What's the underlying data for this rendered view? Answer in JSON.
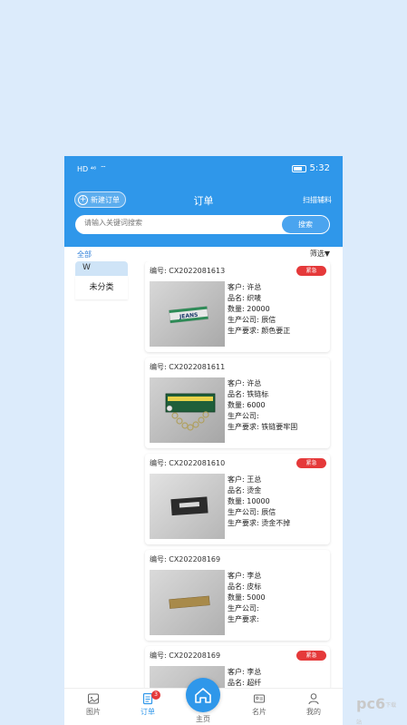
{
  "status_bar": {
    "network": "HD ⁴⁶",
    "time": "5:32"
  },
  "header": {
    "new_order_label": "新建订单",
    "title": "订单",
    "scan_label": "扫描辅料"
  },
  "search": {
    "placeholder": "请输入关键词搜索",
    "button_label": "搜索"
  },
  "filter": {
    "all_label": "全部",
    "filter_label": "筛选▼"
  },
  "sidebar": {
    "group_label": "W",
    "items": [
      {
        "label": "未分类"
      }
    ]
  },
  "orders": [
    {
      "number": "编号: CX2022081613",
      "urgent": "紧急",
      "customer": "客户: 许总",
      "product": "品名: 织唛",
      "quantity": "数量: 20000",
      "company": "生产公司: 辰信",
      "requirement": "生产要求: 颜色要正",
      "image_text": "JEANS"
    },
    {
      "number": "编号: CX2022081611",
      "urgent": "",
      "customer": "客户: 许总",
      "product": "品名: 铁链标",
      "quantity": "数量: 6000",
      "company": "生产公司:",
      "requirement": "生产要求: 铁链要牢固",
      "image_text": ""
    },
    {
      "number": "编号: CX2022081610",
      "urgent": "紧急",
      "customer": "客户: 王总",
      "product": "品名: 烫金",
      "quantity": "数量: 10000",
      "company": "生产公司: 辰信",
      "requirement": "生产要求: 烫金不掉",
      "image_text": ""
    },
    {
      "number": "编号: CX202208169",
      "urgent": "",
      "customer": "客户: 李总",
      "product": "品名: 皮标",
      "quantity": "数量: 5000",
      "company": "生产公司:",
      "requirement": "生产要求:",
      "image_text": ""
    },
    {
      "number": "编号: CX202208169",
      "urgent": "紧急",
      "customer": "客户: 李总",
      "product": "品名: 超纤",
      "quantity": "",
      "company": "",
      "requirement": "",
      "image_text": ""
    }
  ],
  "tabbar": {
    "photos": "图片",
    "orders": "订单",
    "orders_badge": "3",
    "home": "主页",
    "cards": "名片",
    "mine": "我的"
  },
  "colors": {
    "primary": "#2f97ea",
    "urgent": "#e5393a",
    "background": "#dcebfb"
  },
  "watermark": {
    "text": "pc6",
    "sub": "下载站"
  }
}
